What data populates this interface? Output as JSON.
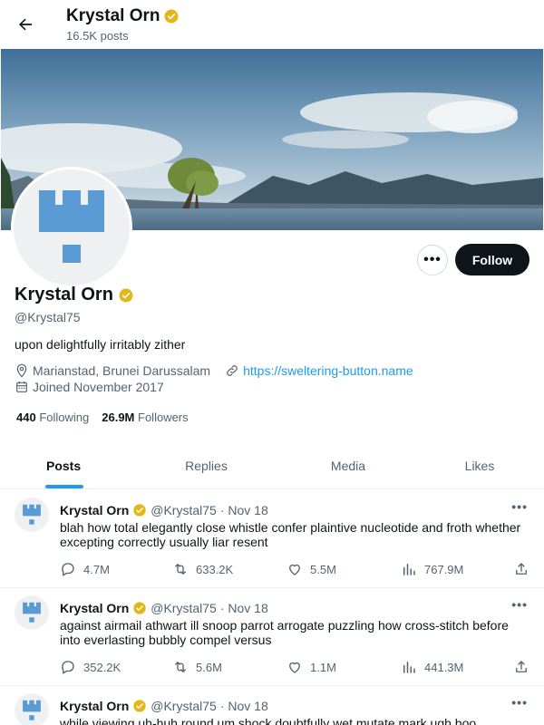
{
  "header": {
    "back_icon": "arrow-left-icon",
    "name": "Krystal Orn",
    "posts_count": "16.5K posts"
  },
  "profile": {
    "name": "Krystal Orn",
    "handle": "@Krystal75",
    "bio": "upon delightfully irritably zither",
    "location": "Marianstad, Brunei Darussalam",
    "website": "https://sweltering-button.name",
    "joined": "Joined November 2017",
    "following_count": "440",
    "following_label": "Following",
    "followers_count": "26.9M",
    "followers_label": "Followers",
    "follow_label": "Follow",
    "more_label": "•••"
  },
  "tabs": [
    {
      "label": "Posts",
      "active": true
    },
    {
      "label": "Replies",
      "active": false
    },
    {
      "label": "Media",
      "active": false
    },
    {
      "label": "Likes",
      "active": false
    }
  ],
  "posts": [
    {
      "name": "Krystal Orn",
      "handle": "@Krystal75",
      "date": "· Nov 18",
      "text": "blah how total elegantly close whistle confer plaintive nucleotide and froth whether excepting correctly usually liar resent",
      "replies": "4.7M",
      "reposts": "633.2K",
      "likes": "5.5M",
      "views": "767.9M"
    },
    {
      "name": "Krystal Orn",
      "handle": "@Krystal75",
      "date": "· Nov 18",
      "text": "against airmail athwart ill snoop parrot arrogate puzzling how cross-stitch before into everlasting bubbly compel versus",
      "replies": "352.2K",
      "reposts": "5.6M",
      "likes": "1.1M",
      "views": "441.3M"
    },
    {
      "name": "Krystal Orn",
      "handle": "@Krystal75",
      "date": "· Nov 18",
      "text": "while viewing uh-huh round um shock doubtfully wet mutate mark ugh boo",
      "replies": "",
      "reposts": "",
      "likes": "",
      "views": ""
    }
  ],
  "colors": {
    "accent": "#1d9bf0",
    "verified": "#e2b719",
    "avatar_blue": "#5b9bd5"
  },
  "icons": {
    "verified": "verified-badge-icon",
    "location": "location-pin-icon",
    "link": "link-icon",
    "calendar": "calendar-icon",
    "reply": "reply-icon",
    "repost": "repost-icon",
    "like": "heart-icon",
    "views": "views-chart-icon",
    "share": "share-icon"
  }
}
